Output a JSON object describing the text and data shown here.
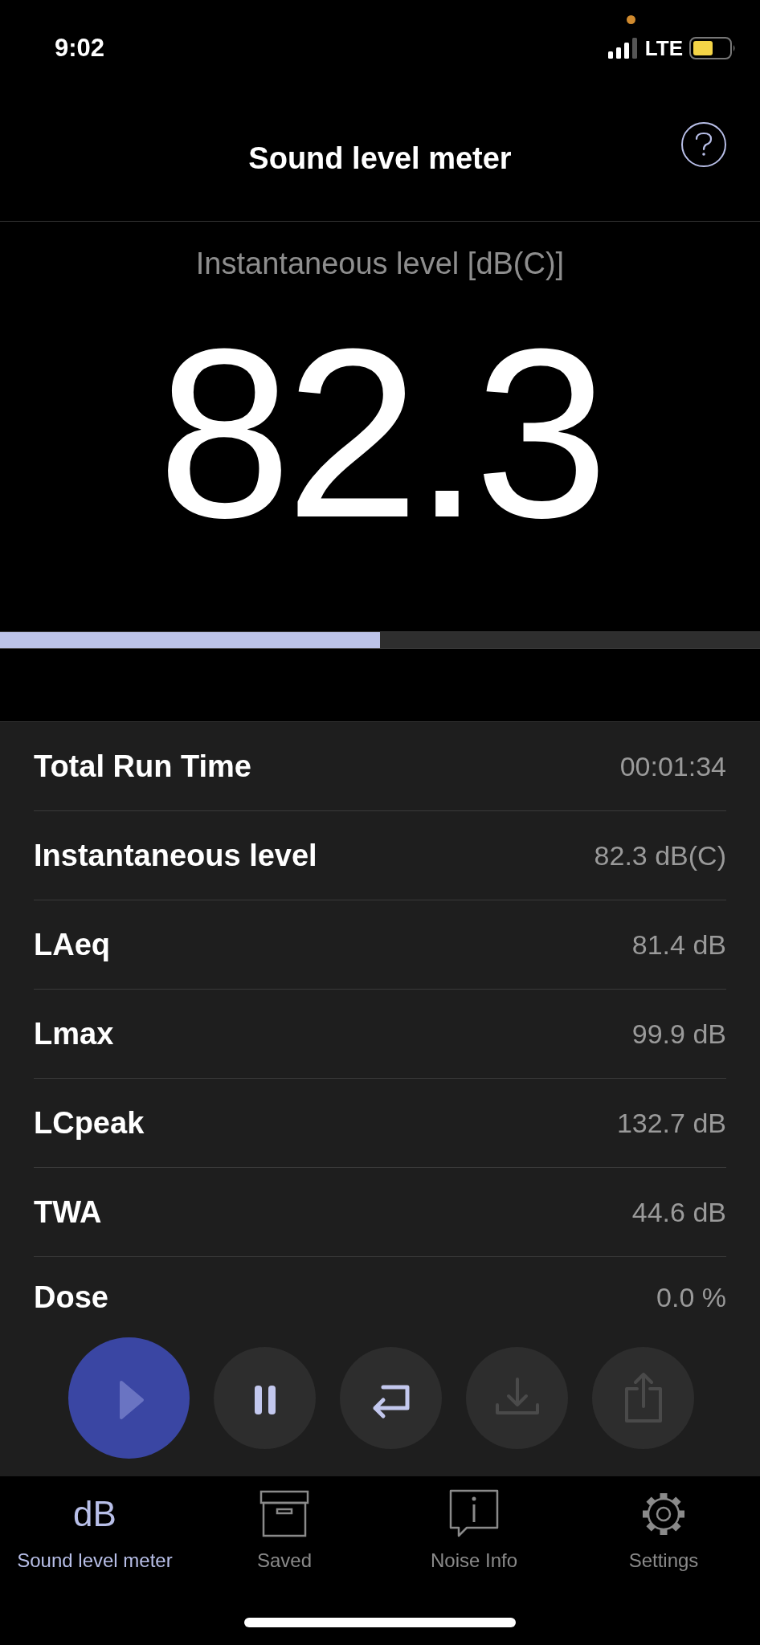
{
  "status_bar": {
    "time": "9:02",
    "network": "LTE"
  },
  "header": {
    "title": "Sound level meter"
  },
  "meter": {
    "label": "Instantaneous level [dB(C)]",
    "reading": "82.3",
    "level": 0.5
  },
  "stats": [
    {
      "label": "Total Run Time",
      "value": "00:01:34"
    },
    {
      "label": "Instantaneous level",
      "value": "82.3 dB(C)"
    },
    {
      "label": "LAeq",
      "value": "81.4 dB"
    },
    {
      "label": "Lmax",
      "value": "99.9 dB"
    },
    {
      "label": "LCpeak",
      "value": "132.7 dB"
    },
    {
      "label": "TWA",
      "value": "44.6 dB"
    },
    {
      "label": "Dose",
      "value": "0.0 %"
    }
  ],
  "controls": [
    {
      "kind": "play",
      "disabled": true
    },
    {
      "kind": "pause",
      "disabled": false
    },
    {
      "kind": "reset",
      "disabled": false
    },
    {
      "kind": "save",
      "disabled": true
    },
    {
      "kind": "share",
      "disabled": true
    }
  ],
  "tabs": [
    {
      "kind": "text",
      "icon_text": "dB",
      "label": "Sound level meter",
      "selected": true
    },
    {
      "kind": "box",
      "label": "Saved",
      "selected": false
    },
    {
      "kind": "info",
      "label": "Noise Info",
      "selected": false
    },
    {
      "kind": "gear",
      "label": "Settings",
      "selected": false
    }
  ]
}
